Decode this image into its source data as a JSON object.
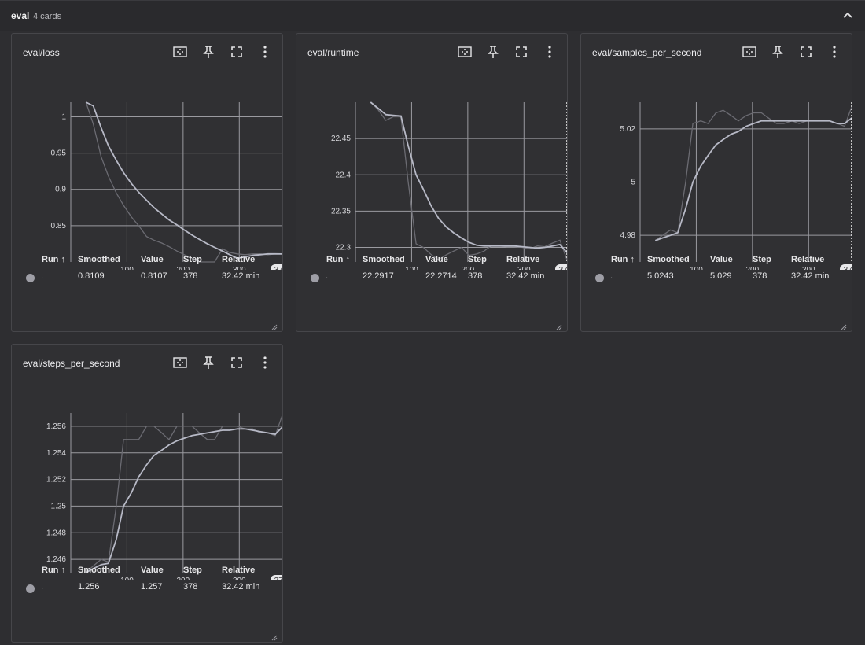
{
  "group": {
    "title": "eval",
    "count": "4 cards"
  },
  "table_headers": {
    "run": "Run ↑",
    "smoothed": "Smoothed",
    "value": "Value",
    "step": "Step",
    "relative": "Relative"
  },
  "step_badge": "378",
  "colors": {
    "raw_line": "#6b6b72",
    "smoothed_line": "#b7b9c6",
    "grid": "#9a9aa0",
    "background": "#2e2e31",
    "card": "#303033"
  },
  "cards": [
    {
      "title": "eval/loss",
      "row": {
        "run": ".",
        "smoothed": "0.8109",
        "value": "0.8107",
        "step": "378",
        "relative": "32.42 min"
      },
      "chart_data": {
        "type": "line",
        "xlim": [
          0,
          378
        ],
        "xticks": [
          100,
          200,
          300
        ],
        "ylim": [
          0.8,
          1.02
        ],
        "yticks": [
          0.85,
          0.9,
          0.95,
          1
        ],
        "ytick_labels": [
          "0.85",
          "0.9",
          "0.95",
          "1"
        ],
        "series": [
          {
            "role": "raw",
            "x": [
              27,
              40,
              54,
              67,
              81,
              94,
              108,
              121,
              135,
              148,
              162,
              175,
              189,
              202,
              216,
              229,
              243,
              256,
              270,
              283,
              297,
              310,
              324,
              337,
              351,
              364,
              378
            ],
            "y": [
              1.05,
              0.99,
              0.945,
              0.918,
              0.895,
              0.878,
              0.862,
              0.85,
              0.835,
              0.83,
              0.826,
              0.821,
              0.815,
              0.81,
              0.805,
              0.8,
              0.8,
              0.8,
              0.818,
              0.813,
              0.811,
              0.81,
              0.811,
              0.811,
              0.81,
              0.811,
              0.8107
            ]
          },
          {
            "role": "smoothed",
            "x": [
              27,
              40,
              54,
              67,
              81,
              94,
              108,
              121,
              135,
              148,
              162,
              175,
              189,
              202,
              216,
              229,
              243,
              256,
              270,
              283,
              297,
              310,
              324,
              337,
              351,
              364,
              378
            ],
            "y": [
              1.05,
              1.015,
              0.985,
              0.96,
              0.94,
              0.923,
              0.908,
              0.896,
              0.885,
              0.875,
              0.866,
              0.858,
              0.851,
              0.844,
              0.837,
              0.831,
              0.825,
              0.82,
              0.815,
              0.81,
              0.805,
              0.807,
              0.809,
              0.81,
              0.811,
              0.811,
              0.8109
            ]
          }
        ]
      }
    },
    {
      "title": "eval/runtime",
      "row": {
        "run": ".",
        "smoothed": "22.2917",
        "value": "22.2714",
        "step": "378",
        "relative": "32.42 min"
      },
      "chart_data": {
        "type": "line",
        "xlim": [
          0,
          378
        ],
        "xticks": [
          100,
          200,
          300
        ],
        "ylim": [
          22.28,
          22.5
        ],
        "yticks": [
          22.3,
          22.35,
          22.4,
          22.45
        ],
        "ytick_labels": [
          "22.3",
          "22.35",
          "22.4",
          "22.45"
        ],
        "series": [
          {
            "role": "raw",
            "x": [
              27,
              40,
              54,
              67,
              81,
              94,
              108,
              121,
              135,
              148,
              162,
              175,
              189,
              202,
              216,
              229,
              243,
              256,
              270,
              283,
              297,
              310,
              324,
              337,
              351,
              364,
              378
            ],
            "y": [
              22.5,
              22.49,
              22.475,
              22.48,
              22.48,
              22.39,
              22.305,
              22.3,
              22.29,
              22.283,
              22.29,
              22.295,
              22.3,
              22.289,
              22.291,
              22.295,
              22.303,
              22.302,
              22.301,
              22.301,
              22.3,
              22.298,
              22.302,
              22.301,
              22.306,
              22.31,
              22.2714
            ]
          },
          {
            "role": "smoothed",
            "x": [
              27,
              40,
              54,
              67,
              81,
              94,
              108,
              121,
              135,
              148,
              162,
              175,
              189,
              202,
              216,
              229,
              243,
              256,
              270,
              283,
              297,
              310,
              324,
              337,
              351,
              364,
              378
            ],
            "y": [
              22.5,
              22.492,
              22.483,
              22.482,
              22.481,
              22.44,
              22.4,
              22.38,
              22.357,
              22.34,
              22.328,
              22.32,
              22.313,
              22.307,
              22.303,
              22.302,
              22.302,
              22.302,
              22.302,
              22.302,
              22.301,
              22.3,
              22.299,
              22.3,
              22.302,
              22.304,
              22.2917
            ]
          }
        ]
      }
    },
    {
      "title": "eval/samples_per_second",
      "row": {
        "run": ".",
        "smoothed": "5.0243",
        "value": "5.029",
        "step": "378",
        "relative": "32.42 min"
      },
      "chart_data": {
        "type": "line",
        "xlim": [
          0,
          378
        ],
        "xticks": [
          100,
          200,
          300
        ],
        "ylim": [
          4.97,
          5.03
        ],
        "yticks": [
          4.98,
          5,
          5.02
        ],
        "ytick_labels": [
          "4.98",
          "5",
          "5.02"
        ],
        "series": [
          {
            "role": "raw",
            "x": [
              27,
              40,
              54,
              67,
              81,
              94,
              108,
              121,
              135,
              148,
              162,
              175,
              189,
              202,
              216,
              229,
              243,
              256,
              270,
              283,
              297,
              310,
              324,
              337,
              351,
              364,
              378
            ],
            "y": [
              4.978,
              4.98,
              4.982,
              4.981,
              5.0,
              5.022,
              5.023,
              5.022,
              5.026,
              5.027,
              5.025,
              5.023,
              5.025,
              5.026,
              5.026,
              5.024,
              5.022,
              5.022,
              5.023,
              5.022,
              5.023,
              5.023,
              5.023,
              5.023,
              5.022,
              5.021,
              5.029
            ]
          },
          {
            "role": "smoothed",
            "x": [
              27,
              40,
              54,
              67,
              81,
              94,
              108,
              121,
              135,
              148,
              162,
              175,
              189,
              202,
              216,
              229,
              243,
              256,
              270,
              283,
              297,
              310,
              324,
              337,
              351,
              364,
              378
            ],
            "y": [
              4.978,
              4.979,
              4.98,
              4.981,
              4.99,
              5.0,
              5.006,
              5.01,
              5.014,
              5.016,
              5.018,
              5.019,
              5.021,
              5.022,
              5.023,
              5.023,
              5.023,
              5.023,
              5.023,
              5.023,
              5.023,
              5.023,
              5.023,
              5.023,
              5.022,
              5.022,
              5.0243
            ]
          }
        ]
      }
    },
    {
      "title": "eval/steps_per_second",
      "row": {
        "run": ".",
        "smoothed": "1.256",
        "value": "1.257",
        "step": "378",
        "relative": "32.42 min"
      },
      "chart_data": {
        "type": "line",
        "xlim": [
          0,
          378
        ],
        "xticks": [
          100,
          200,
          300
        ],
        "ylim": [
          1.245,
          1.257
        ],
        "yticks": [
          1.246,
          1.248,
          1.25,
          1.252,
          1.254,
          1.256
        ],
        "ytick_labels": [
          "1.246",
          "1.248",
          "1.25",
          "1.252",
          "1.254",
          "1.256"
        ],
        "series": [
          {
            "role": "raw",
            "x": [
              27,
              40,
              54,
              67,
              81,
              94,
              108,
              121,
              135,
              148,
              162,
              175,
              189,
              202,
              216,
              229,
              243,
              256,
              270,
              283,
              297,
              310,
              324,
              337,
              351,
              364,
              378
            ],
            "y": [
              1.245,
              1.2455,
              1.246,
              1.2458,
              1.25,
              1.255,
              1.255,
              1.255,
              1.256,
              1.256,
              1.2555,
              1.255,
              1.256,
              1.256,
              1.256,
              1.2555,
              1.255,
              1.255,
              1.256,
              1.256,
              1.256,
              1.2558,
              1.2558,
              1.2555,
              1.2555,
              1.2553,
              1.257
            ]
          },
          {
            "role": "smoothed",
            "x": [
              27,
              40,
              54,
              67,
              81,
              94,
              108,
              121,
              135,
              148,
              162,
              175,
              189,
              202,
              216,
              229,
              243,
              256,
              270,
              283,
              297,
              310,
              324,
              337,
              351,
              364,
              378
            ],
            "y": [
              1.245,
              1.2453,
              1.2456,
              1.2457,
              1.2475,
              1.25,
              1.251,
              1.2522,
              1.2531,
              1.2538,
              1.2542,
              1.2546,
              1.2549,
              1.2551,
              1.2553,
              1.2554,
              1.2555,
              1.2556,
              1.2557,
              1.2557,
              1.2558,
              1.2558,
              1.2557,
              1.2556,
              1.2555,
              1.2554,
              1.256
            ]
          }
        ]
      }
    }
  ]
}
